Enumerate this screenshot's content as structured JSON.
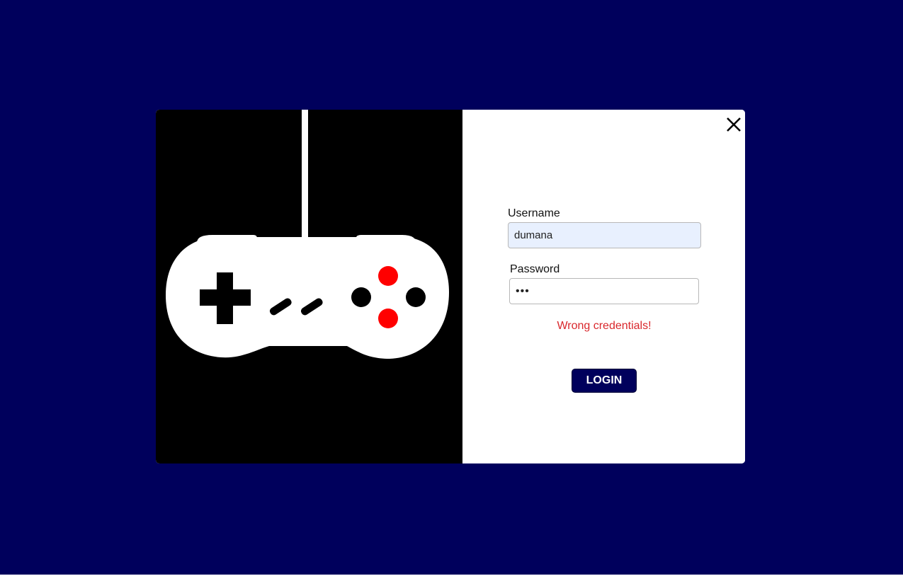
{
  "login_form": {
    "username_label": "Username",
    "username_value": "dumana",
    "password_label": "Password",
    "password_value": "abc",
    "error_message": "Wrong credentials!",
    "login_button_label": "LOGIN"
  },
  "icons": {
    "close": "close-icon",
    "illustration": "game-controller-icon"
  },
  "colors": {
    "page_background": "#00005c",
    "button_background": "#00005c",
    "error_text": "#d9272c",
    "controller_accent": "#ff0000",
    "autofill_background": "#e8f0fe"
  }
}
